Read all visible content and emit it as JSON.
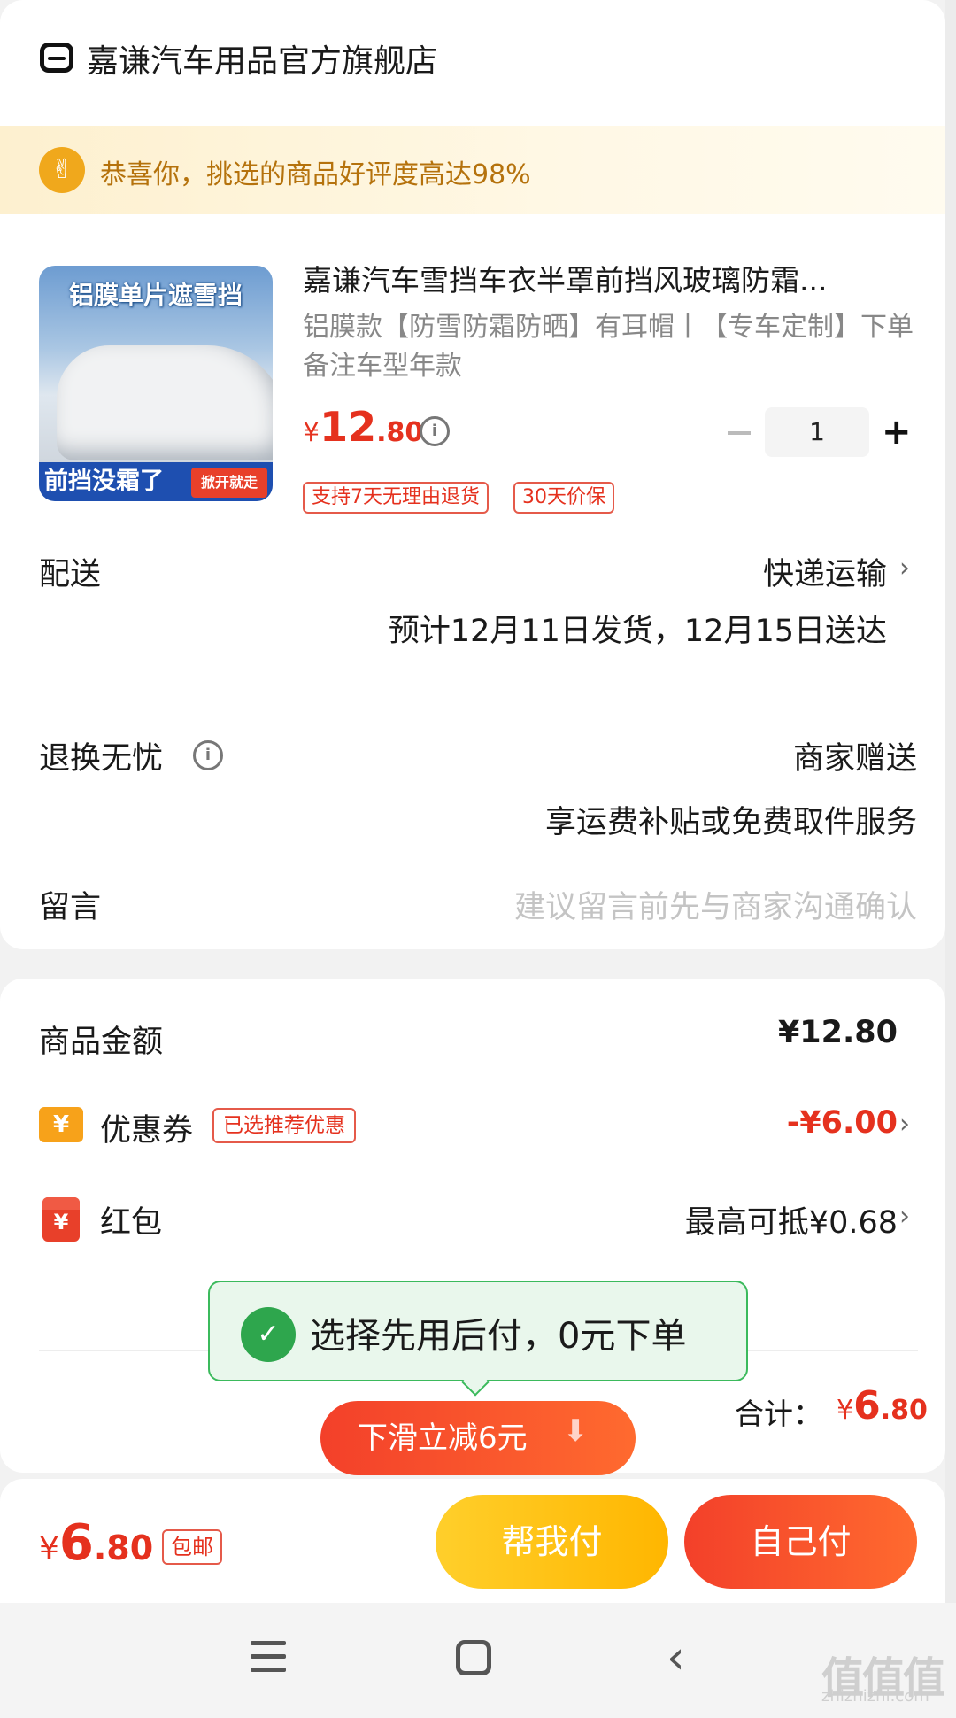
{
  "store": {
    "name": "嘉谦汽车用品官方旗舰店"
  },
  "banner": {
    "text": "恭喜你，挑选的商品好评度高达98%"
  },
  "product": {
    "image_text_top": "铝膜单片遮雪挡",
    "image_text_bottom": "前挡没霜了",
    "image_badge": "掀开就走",
    "title": "嘉谦汽车雪挡车衣半罩前挡风玻璃防霜...",
    "spec": "铝膜款【防雪防霜防晒】有耳帽丨【专车定制】下单备注车型年款",
    "price_currency": "¥",
    "price_int": "12",
    "price_dec": ".80",
    "quantity": "1",
    "tags": [
      "支持7天无理由退货",
      "30天价保"
    ]
  },
  "delivery": {
    "label": "配送",
    "method": "快递运输",
    "estimate": "预计12月11日发货，12月15日送达"
  },
  "returns": {
    "label": "退换无忧",
    "value": "商家赠送",
    "note": "享运费补贴或免费取件服务"
  },
  "message": {
    "label": "留言",
    "placeholder": "建议留言前先与商家沟通确认"
  },
  "summary": {
    "goods_label": "商品金额",
    "goods_value": "¥12.80",
    "coupon_label": "优惠券",
    "coupon_tag": "已选推荐优惠",
    "coupon_value": "-¥6.00",
    "redpack_label": "红包",
    "redpack_value": "最高可抵¥0.68",
    "total_label": "合计：",
    "total_currency": "¥",
    "total_int": "6",
    "total_dec": ".80"
  },
  "tooltip": {
    "text": "选择先用后付，0元下单"
  },
  "slide_button": {
    "label": "下滑立减6元"
  },
  "bottom_bar": {
    "currency": "¥",
    "price_int": "6",
    "price_dec": ".80",
    "shipping_tag": "包邮",
    "help_pay_label": "帮我付",
    "self_pay_label": "自己付"
  },
  "watermark": {
    "text": "值值值",
    "sub": "zhizhizhi.com"
  },
  "icons": {
    "store": "store-icon",
    "thumbs_up": "thumbs-up-icon",
    "info": "info-icon",
    "coupon": "coupon-icon",
    "red_packet": "red-packet-icon"
  },
  "colors": {
    "accent_red": "#e5311e",
    "accent_orange": "#f3402a",
    "gold": "#ffb600",
    "green": "#3bba5c"
  }
}
